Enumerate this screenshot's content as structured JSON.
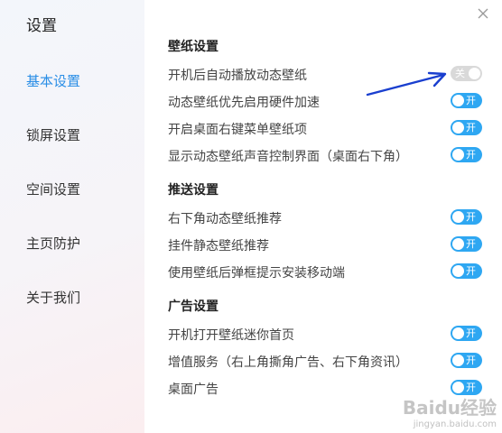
{
  "app": {
    "title": "设置"
  },
  "sidebar": {
    "items": [
      {
        "label": "基本设置",
        "active": true
      },
      {
        "label": "锁屏设置",
        "active": false
      },
      {
        "label": "空间设置",
        "active": false
      },
      {
        "label": "主页防护",
        "active": false
      },
      {
        "label": "关于我们",
        "active": false
      }
    ]
  },
  "sections": [
    {
      "title": "壁纸设置",
      "rows": [
        {
          "label": "开机后自动播放动态壁纸",
          "toggle": "关",
          "state": "off"
        },
        {
          "label": "动态壁纸优先启用硬件加速",
          "toggle": "开",
          "state": "on"
        },
        {
          "label": "开启桌面右键菜单壁纸项",
          "toggle": "开",
          "state": "on"
        },
        {
          "label": "显示动态壁纸声音控制界面（桌面右下角）",
          "toggle": "开",
          "state": "on"
        }
      ]
    },
    {
      "title": "推送设置",
      "rows": [
        {
          "label": "右下角动态壁纸推荐",
          "toggle": "开",
          "state": "on"
        },
        {
          "label": "挂件静态壁纸推荐",
          "toggle": "开",
          "state": "on"
        },
        {
          "label": "使用壁纸后弹框提示安装移动端",
          "toggle": "开",
          "state": "on"
        }
      ]
    },
    {
      "title": "广告设置",
      "rows": [
        {
          "label": "开机打开壁纸迷你首页",
          "toggle": "开",
          "state": "on"
        },
        {
          "label": "增值服务（右上角撕角广告、右下角资讯）",
          "toggle": "开",
          "state": "on"
        },
        {
          "label": "桌面广告",
          "toggle": "开",
          "state": "on"
        }
      ]
    }
  ],
  "watermark": {
    "main": "Baidu经验",
    "sub": "jingyan.baidu.com"
  },
  "colors": {
    "accent": "#2a8ee6",
    "toggle_on": "#2ea7f2",
    "toggle_off": "#d9d9d9",
    "arrow": "#1a3fcf"
  }
}
